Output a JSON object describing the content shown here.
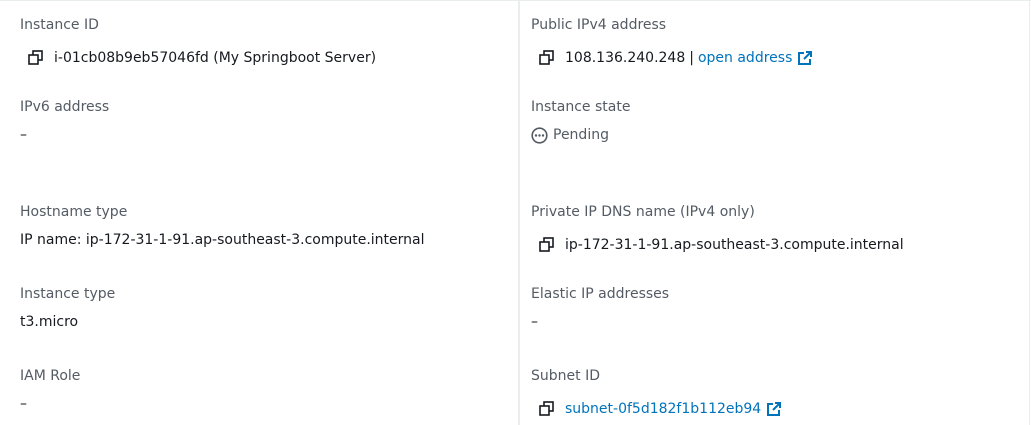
{
  "left": {
    "instance_id": {
      "label": "Instance ID",
      "value": "i-01cb08b9eb57046fd (My Springboot Server)"
    },
    "ipv6": {
      "label": "IPv6 address",
      "value": "–"
    },
    "hostname_type": {
      "label": "Hostname type",
      "value": "IP name: ip-172-31-1-91.ap-southeast-3.compute.internal"
    },
    "instance_type": {
      "label": "Instance type",
      "value": "t3.micro"
    },
    "iam_role": {
      "label": "IAM Role",
      "value": "–"
    }
  },
  "right": {
    "public_ipv4": {
      "label": "Public IPv4 address",
      "value": "108.136.240.248",
      "separator": "|",
      "link_text": "open address"
    },
    "instance_state": {
      "label": "Instance state",
      "value": "Pending"
    },
    "private_dns": {
      "label": "Private IP DNS name (IPv4 only)",
      "value": "ip-172-31-1-91.ap-southeast-3.compute.internal"
    },
    "elastic_ip": {
      "label": "Elastic IP addresses",
      "value": "–"
    },
    "subnet_id": {
      "label": "Subnet ID",
      "value": "subnet-0f5d182f1b112eb94"
    }
  },
  "colors": {
    "label": "#545b64",
    "text": "#16191f",
    "link": "#0073bb",
    "divider": "#eaeded"
  },
  "icons": [
    "copy-icon",
    "external-link-icon",
    "pending-status-icon"
  ]
}
